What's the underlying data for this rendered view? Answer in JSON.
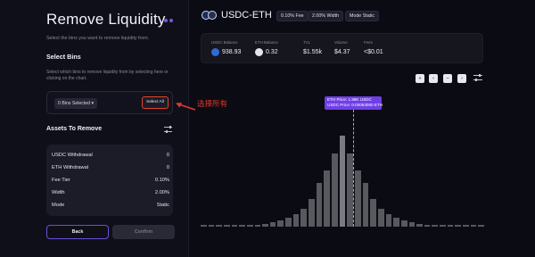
{
  "left": {
    "title": "Remove Liquidity",
    "subtitle": "Select the bins you want to remove liquidity from.",
    "select_bins_heading": "Select Bins",
    "select_bins_desc": "Select which bins to remove liquidity from by selecting here or clicking on the chart.",
    "bins_selected": "0 Bins Selected",
    "select_all": "Select All",
    "assets_heading": "Assets To Remove",
    "rows": [
      {
        "label": "USDC Withdrawal",
        "value": "0"
      },
      {
        "label": "ETH Withdrawal",
        "value": "0"
      },
      {
        "label": "Fee Tier",
        "value": "0.10%"
      },
      {
        "label": "Width",
        "value": "2.00%"
      },
      {
        "label": "Mode",
        "value": "Static"
      }
    ],
    "back": "Back",
    "confirm": "Confirm"
  },
  "header": {
    "pair": "USDC-ETH",
    "fee_tag": "0.10% Fee",
    "width_tag": "2.00% Width",
    "mode_tag": "Mode Static"
  },
  "stats": {
    "usdc_balance_label": "USDC Balance",
    "usdc_balance": "938.93",
    "eth_balance_label": "ETH Balance",
    "eth_balance": "0.32",
    "tvl_label": "TVL",
    "tvl": "$1.55k",
    "volume_label": "Volume",
    "volume": "$4.37",
    "fees_label": "Fees",
    "fees": "<$0.01"
  },
  "nav": {
    "first": "«",
    "prev": "‹",
    "reset": "–",
    "next": "›"
  },
  "tooltip": {
    "eth_price": "ETH Price: 1.88K USDC",
    "usdc_price": "USDC Price: 0.00053050 ETH"
  },
  "annotation": "选择所有",
  "chart_data": {
    "type": "bar",
    "values": [
      1,
      1,
      1,
      1,
      1,
      1,
      1,
      1,
      3,
      5,
      7,
      10,
      14,
      20,
      30,
      48,
      62,
      80,
      100,
      80,
      62,
      48,
      30,
      20,
      14,
      10,
      7,
      5,
      3,
      1,
      1,
      1,
      1,
      1,
      1,
      1,
      1
    ],
    "highlight_index": 18
  },
  "colors": {
    "accent": "#7a55e0",
    "annotation": "#e03a2a",
    "bar": "#58585f"
  }
}
